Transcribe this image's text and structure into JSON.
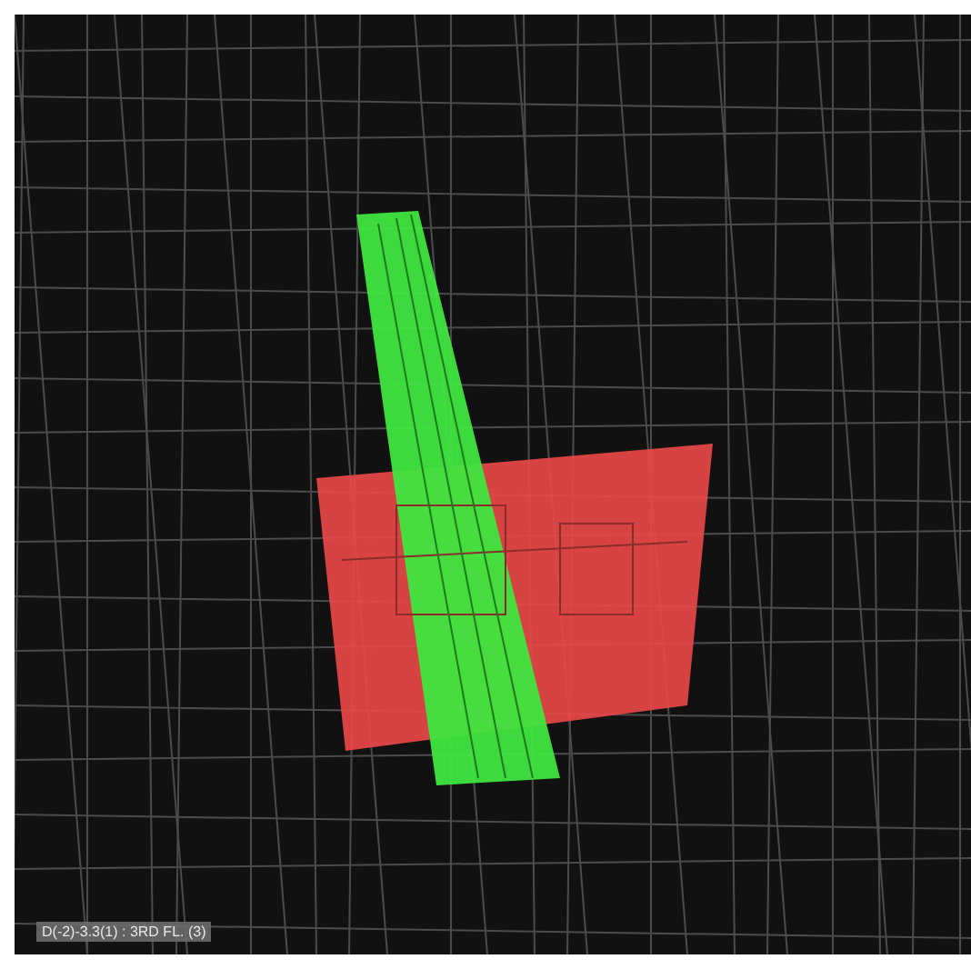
{
  "viewport": {
    "element_label": "D(-2)-3.3(1) : 3RD FL. (3)"
  }
}
